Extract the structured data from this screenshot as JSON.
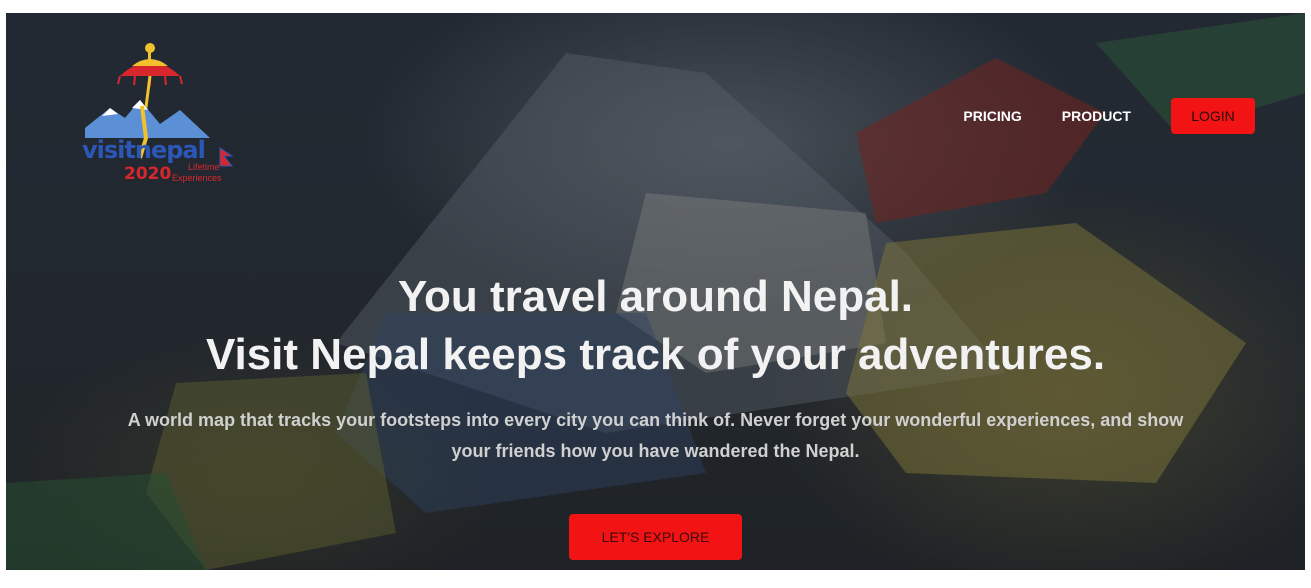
{
  "brand": {
    "logo_text": "visitnepal",
    "logo_year": "2020",
    "logo_tagline_1": "Lifetime",
    "logo_tagline_2": "Experiences"
  },
  "nav": {
    "items": [
      {
        "label": "PRICING"
      },
      {
        "label": "PRODUCT"
      }
    ],
    "login_label": "LOGIN"
  },
  "hero": {
    "headline_line1": "You travel around Nepal.",
    "headline_line2": "Visit Nepal keeps track of your adventures.",
    "subtext": "A world map that tracks your footsteps into every city you can think of. Never forget your wonderful experiences, and show your friends how you have wandered the Nepal.",
    "cta_label": "LET'S EXPLORE"
  },
  "colors": {
    "accent": "#f21414",
    "hero_text": "#f2f2f2",
    "subtext": "#d0d0d0"
  }
}
